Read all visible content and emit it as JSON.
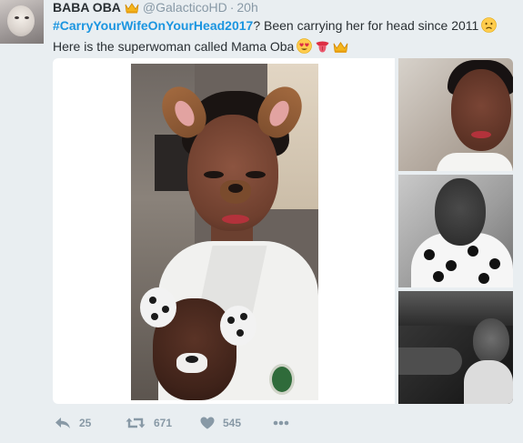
{
  "tweet": {
    "author_name": "BABA OBA",
    "author_badge_icon": "crown-emoji",
    "handle": "@GalacticoHD",
    "separator": "·",
    "time": "20h",
    "hashtag": "#CarryYourWifeOnYourHead2017",
    "text_line1": "? Been carrying her for head since 2011",
    "text_line2": "Here is the superwoman called Mama Oba",
    "emoji_line1": "disappointed-face-emoji",
    "emojis_line2": [
      "heart-eyes-emoji",
      "tongue-emoji",
      "crown-emoji"
    ],
    "accent_color": "#1b95e0",
    "text_color": "#292f33",
    "muted_color": "#8899a6"
  },
  "media": {
    "main_photo": "woman-and-child-snapchat-dog-filter-photo",
    "thumbnails": [
      "woman-portrait-photo",
      "woman-polka-dot-shirt-photo",
      "woman-smiling-dark-photo"
    ]
  },
  "actions": {
    "reply_icon": "reply-icon",
    "reply_count": "25",
    "retweet_icon": "retweet-icon",
    "retweet_count": "671",
    "like_icon": "heart-icon",
    "like_count": "545",
    "more_icon": "more-dots-icon"
  }
}
